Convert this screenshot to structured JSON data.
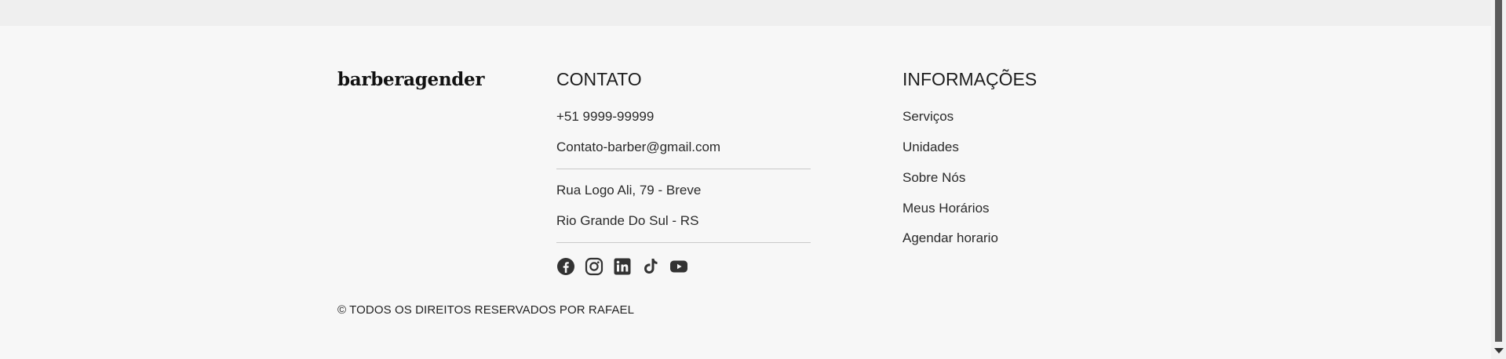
{
  "brand": {
    "name": "barberagender"
  },
  "contact": {
    "title": "CONTATO",
    "phone": "+51 9999-99999",
    "email": "Contato-barber@gmail.com",
    "address_line1": "Rua Logo Ali, 79 - Breve",
    "address_line2": "Rio Grande Do Sul - RS"
  },
  "social": [
    {
      "icon": "facebook-icon"
    },
    {
      "icon": "instagram-icon"
    },
    {
      "icon": "linkedin-icon"
    },
    {
      "icon": "tiktok-icon"
    },
    {
      "icon": "youtube-icon"
    }
  ],
  "info": {
    "title": "INFORMAÇÕES",
    "links": [
      "Serviços",
      "Unidades",
      "Sobre Nós",
      "Meus Horários",
      "Agendar horario"
    ]
  },
  "copyright": "© TODOS OS DIREITOS RESERVADOS POR RAFAEL",
  "colors": {
    "background": "#f7f7f7",
    "top_band": "#efefef",
    "text": "#222222",
    "icon": "#333333"
  }
}
